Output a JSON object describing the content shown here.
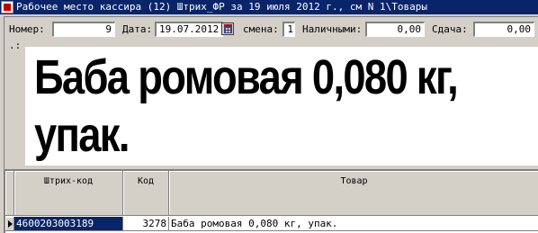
{
  "window": {
    "title": "Рабочее место кассира (12) Штрих_ФР за 19 июля 2012 г., см N 1\\Товары"
  },
  "fields": {
    "number_label": "Номер:",
    "number_value": "9",
    "date_label": "Дата:",
    "date_value": "19.07.2012",
    "shift_label": "смена:",
    "shift_value": "1",
    "cash_label": "Наличными:",
    "cash_value": "0,00",
    "change_label": "Сдача:",
    "change_value": "0,00"
  },
  "separator_label": ".:",
  "display": {
    "line1": "Баба ромовая 0,080 кг,",
    "line2": "упак."
  },
  "grid": {
    "columns": [
      "Штрих-код",
      "Код",
      "Товар"
    ],
    "rows": [
      {
        "barcode": "4600203003189",
        "code": "3278",
        "name": "Баба ромовая 0,080 кг, упак."
      }
    ]
  }
}
